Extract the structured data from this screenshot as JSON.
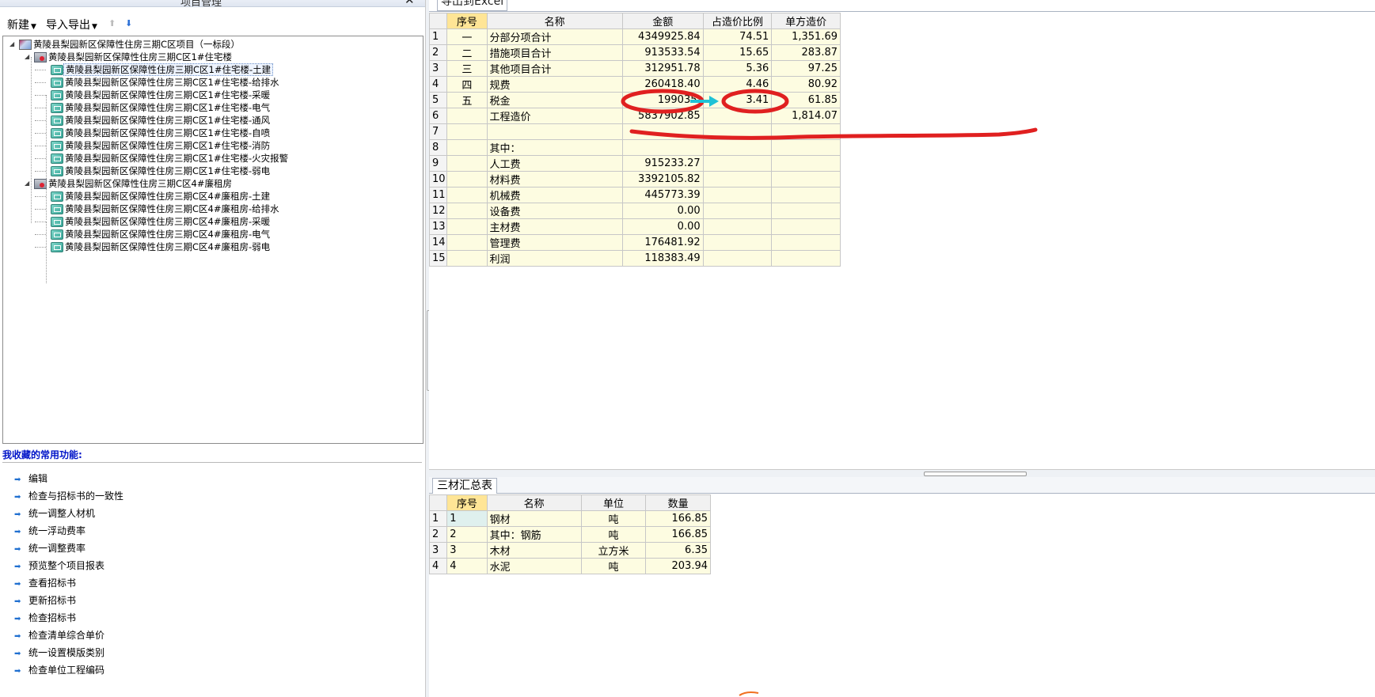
{
  "left_panel": {
    "title": "项目管理",
    "close_glyph": "✕",
    "toolbar": {
      "new_label": "新建",
      "import_export_label": "导入导出"
    },
    "tree": [
      {
        "label": "黄陵县梨园新区保障性住房三期C区项目（一标段）",
        "icon": "project-icon",
        "level": 0
      },
      {
        "label": "黄陵县梨园新区保障性住房三期C区1#住宅楼",
        "icon": "building-icon",
        "level": 1
      },
      {
        "label": "黄陵县梨园新区保障性住房三期C区1#住宅楼-土建",
        "icon": "unit-icon",
        "level": 2,
        "selected": true
      },
      {
        "label": "黄陵县梨园新区保障性住房三期C区1#住宅楼-给排水",
        "icon": "unit-icon",
        "level": 2
      },
      {
        "label": "黄陵县梨园新区保障性住房三期C区1#住宅楼-采暖",
        "icon": "unit-icon",
        "level": 2
      },
      {
        "label": "黄陵县梨园新区保障性住房三期C区1#住宅楼-电气",
        "icon": "unit-icon",
        "level": 2
      },
      {
        "label": "黄陵县梨园新区保障性住房三期C区1#住宅楼-通风",
        "icon": "unit-icon",
        "level": 2
      },
      {
        "label": "黄陵县梨园新区保障性住房三期C区1#住宅楼-自喷",
        "icon": "unit-icon",
        "level": 2
      },
      {
        "label": "黄陵县梨园新区保障性住房三期C区1#住宅楼-消防",
        "icon": "unit-icon",
        "level": 2
      },
      {
        "label": "黄陵县梨园新区保障性住房三期C区1#住宅楼-火灾报警",
        "icon": "unit-icon",
        "level": 2
      },
      {
        "label": "黄陵县梨园新区保障性住房三期C区1#住宅楼-弱电",
        "icon": "unit-icon",
        "level": 2
      },
      {
        "label": "黄陵县梨园新区保障性住房三期C区4#廉租房",
        "icon": "building-icon",
        "level": 1
      },
      {
        "label": "黄陵县梨园新区保障性住房三期C区4#廉租房-土建",
        "icon": "unit-icon",
        "level": 2
      },
      {
        "label": "黄陵县梨园新区保障性住房三期C区4#廉租房-给排水",
        "icon": "unit-icon",
        "level": 2
      },
      {
        "label": "黄陵县梨园新区保障性住房三期C区4#廉租房-采暖",
        "icon": "unit-icon",
        "level": 2
      },
      {
        "label": "黄陵县梨园新区保障性住房三期C区4#廉租房-电气",
        "icon": "unit-icon",
        "level": 2
      },
      {
        "label": "黄陵县梨园新区保障性住房三期C区4#廉租房-弱电",
        "icon": "unit-icon",
        "level": 2
      }
    ],
    "favorites_title": "我收藏的常用功能:",
    "favorites": [
      "编辑",
      "检查与招标书的一致性",
      "统一调整人材机",
      "统一浮动费率",
      "统一调整费率",
      "预览整个项目报表",
      "查看招标书",
      "更新招标书",
      "检查招标书",
      "检查清单综合单价",
      "统一设置模版类别",
      "检查单位工程编码"
    ]
  },
  "summary": {
    "tab_label": "导出到Excel",
    "headers": [
      "序号",
      "名称",
      "金额",
      "占造价比例",
      "单方造价"
    ],
    "rows": [
      {
        "n": "1",
        "seq": "一",
        "name": "分部分项合计",
        "amount": "4349925.84",
        "ratio": "74.51",
        "unit_cost": "1,351.69"
      },
      {
        "n": "2",
        "seq": "二",
        "name": "措施项目合计",
        "amount": "913533.54",
        "ratio": "15.65",
        "unit_cost": "283.87"
      },
      {
        "n": "3",
        "seq": "三",
        "name": "其他项目合计",
        "amount": "312951.78",
        "ratio": "5.36",
        "unit_cost": "97.25"
      },
      {
        "n": "4",
        "seq": "四",
        "name": "规费",
        "amount": "260418.40",
        "ratio": "4.46",
        "unit_cost": "80.92"
      },
      {
        "n": "5",
        "seq": "五",
        "name": "税金",
        "amount": "199035.",
        "ratio": "3.41",
        "unit_cost": "61.85"
      },
      {
        "n": "6",
        "seq": "",
        "name": "工程造价",
        "amount": "5837902.85",
        "ratio": "",
        "unit_cost": "1,814.07"
      },
      {
        "n": "7",
        "seq": "",
        "name": "",
        "amount": "",
        "ratio": "",
        "unit_cost": ""
      },
      {
        "n": "8",
        "seq": "",
        "name": "其中：",
        "amount": "",
        "ratio": "",
        "unit_cost": ""
      },
      {
        "n": "9",
        "seq": "",
        "name": "人工费",
        "amount": "915233.27",
        "ratio": "",
        "unit_cost": ""
      },
      {
        "n": "10",
        "seq": "",
        "name": "材料费",
        "amount": "3392105.82",
        "ratio": "",
        "unit_cost": ""
      },
      {
        "n": "11",
        "seq": "",
        "name": "机械费",
        "amount": "445773.39",
        "ratio": "",
        "unit_cost": ""
      },
      {
        "n": "12",
        "seq": "",
        "name": "设备费",
        "amount": "0.00",
        "ratio": "",
        "unit_cost": ""
      },
      {
        "n": "13",
        "seq": "",
        "name": "主材费",
        "amount": "0.00",
        "ratio": "",
        "unit_cost": ""
      },
      {
        "n": "14",
        "seq": "",
        "name": "管理费",
        "amount": "176481.92",
        "ratio": "",
        "unit_cost": ""
      },
      {
        "n": "15",
        "seq": "",
        "name": "利润",
        "amount": "118383.49",
        "ratio": "",
        "unit_cost": ""
      }
    ]
  },
  "materials": {
    "tab_label": "三材汇总表",
    "headers": [
      "序号",
      "名称",
      "单位",
      "数量"
    ],
    "rows": [
      {
        "n": "1",
        "seq": "1",
        "name": "钢材",
        "unit": "吨",
        "qty": "166.85"
      },
      {
        "n": "2",
        "seq": "2",
        "name": "其中：钢筋",
        "unit": "吨",
        "qty": "166.85"
      },
      {
        "n": "3",
        "seq": "3",
        "name": "木材",
        "unit": "立方米",
        "qty": "6.35"
      },
      {
        "n": "4",
        "seq": "4",
        "name": "水泥",
        "unit": "吨",
        "qty": "203.94"
      }
    ]
  },
  "colors": {
    "annotation_red": "#e02020",
    "annotation_arrow": "#1fc2d6",
    "header_highlight": "#ffe596",
    "cell_bg": "#fdfce1",
    "favorites_title": "#0014c8"
  }
}
